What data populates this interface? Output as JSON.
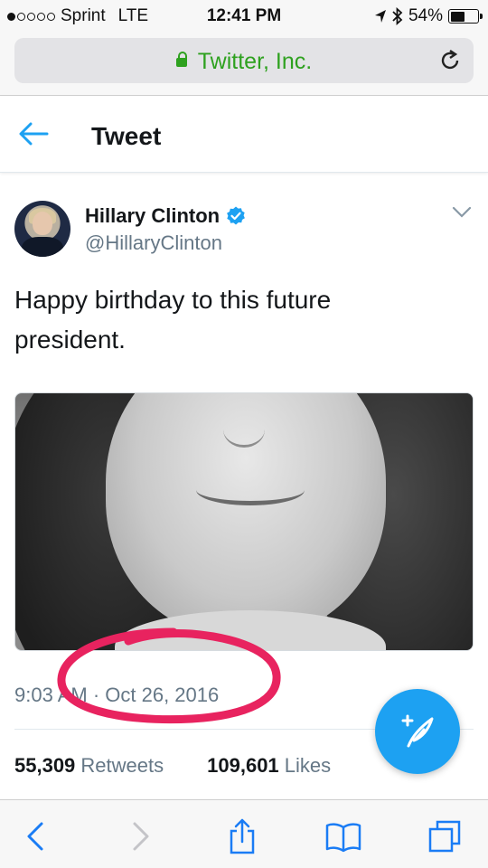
{
  "status_bar": {
    "carrier": "Sprint",
    "network": "LTE",
    "time": "12:41 PM",
    "battery": "54%",
    "battery_level": 0.54
  },
  "browser": {
    "address": "Twitter, Inc."
  },
  "header": {
    "title": "Tweet"
  },
  "tweet": {
    "display_name": "Hillary Clinton",
    "handle": "@HillaryClinton",
    "text": "Happy birthday to this future president.",
    "timestamp": "9:03 AM · Oct 26, 2016",
    "retweets_count": "55,309",
    "retweets_label": "Retweets",
    "likes_count": "109,601",
    "likes_label": "Likes"
  },
  "colors": {
    "accent": "#1da1f2",
    "secure_green": "#2ea11f",
    "annotation": "#e8235f"
  },
  "icons": [
    "lock-icon",
    "reload-icon",
    "back-arrow-icon",
    "verified-icon",
    "chevron-down-icon",
    "compose-icon",
    "safari-back-icon",
    "safari-forward-icon",
    "share-icon",
    "bookmarks-icon",
    "tabs-icon"
  ]
}
